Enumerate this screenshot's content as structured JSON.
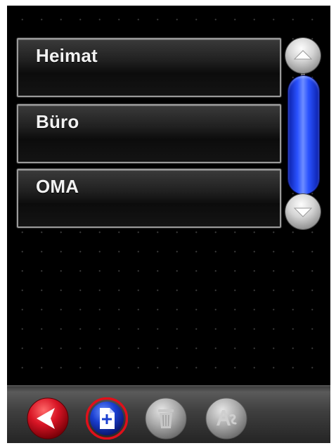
{
  "list": {
    "items": [
      {
        "label": "Heimat"
      },
      {
        "label": "Büro"
      },
      {
        "label": "OMA"
      }
    ]
  },
  "scrollbar": {
    "up_icon": "arrow-up-icon",
    "down_icon": "arrow-down-icon"
  },
  "toolbar": {
    "buttons": [
      {
        "icon": "back-arrow-icon",
        "state": "enabled"
      },
      {
        "icon": "new-document-icon",
        "state": "selected"
      },
      {
        "icon": "trash-icon",
        "state": "disabled"
      },
      {
        "icon": "rename-text-icon",
        "state": "disabled"
      }
    ]
  },
  "colors": {
    "screen_background": "#000000",
    "scroll_thumb": "#2a52ff",
    "back_button": "#cc1020",
    "new_button_fill": "#1a3fd0",
    "selection_ring": "#e0101a",
    "disabled_button": "#a9a9a9"
  }
}
